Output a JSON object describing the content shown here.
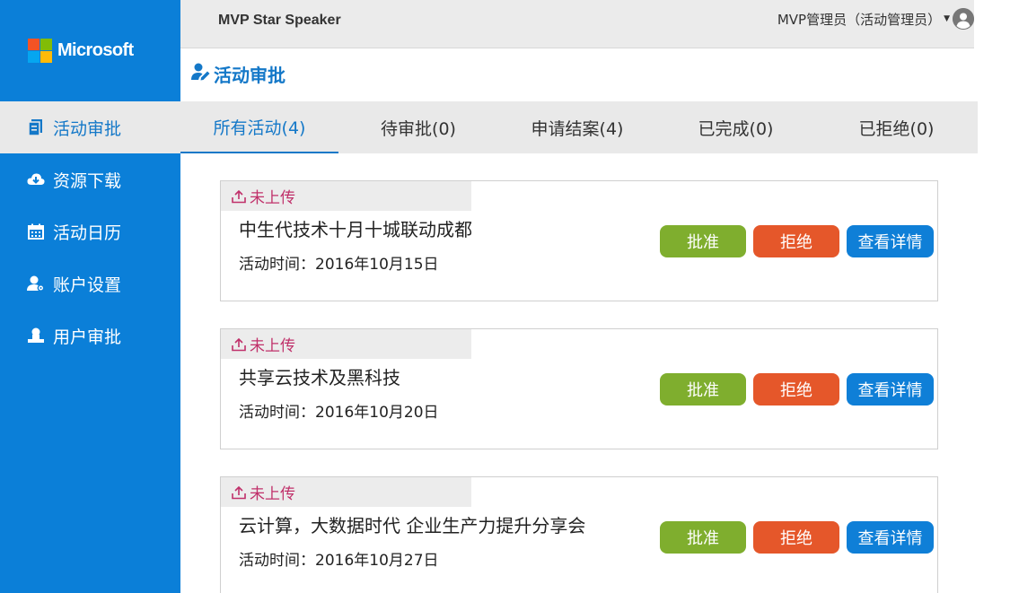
{
  "brand": {
    "name": "Microsoft",
    "colors": [
      "#f35325",
      "#81bc06",
      "#05a6f0",
      "#ffba08"
    ]
  },
  "sidebar": {
    "items": [
      {
        "label": "活动审批",
        "icon": "document-icon",
        "active": true
      },
      {
        "label": "资源下载",
        "icon": "cloud-download-icon",
        "active": false
      },
      {
        "label": "活动日历",
        "icon": "calendar-icon",
        "active": false
      },
      {
        "label": "账户设置",
        "icon": "user-settings-icon",
        "active": false
      },
      {
        "label": "用户审批",
        "icon": "user-approve-icon",
        "active": false
      }
    ]
  },
  "header": {
    "app_name": "MVP Star Speaker",
    "user": "MVP管理员（活动管理员）"
  },
  "page": {
    "title": "活动审批"
  },
  "tabs": [
    {
      "label": "所有活动(4)",
      "active": true
    },
    {
      "label": "待审批(0)",
      "active": false
    },
    {
      "label": "申请结案(4)",
      "active": false
    },
    {
      "label": "已完成(0)",
      "active": false
    },
    {
      "label": "已拒绝(0)",
      "active": false
    }
  ],
  "activities": [
    {
      "status": "未上传",
      "title": "中生代技术十月十城联动成都",
      "time": "活动时间：2016年10月15日"
    },
    {
      "status": "未上传",
      "title": "共享云技术及黑科技",
      "time": "活动时间：2016年10月20日"
    },
    {
      "status": "未上传",
      "title": "云计算，大数据时代 企业生产力提升分享会",
      "time": "活动时间：2016年10月27日"
    }
  ],
  "buttons": {
    "approve": "批准",
    "reject": "拒绝",
    "detail": "查看详情"
  },
  "colors": {
    "sidebar": "#0b7fd8",
    "accent": "#1478c8",
    "approve": "#7fae2e",
    "reject": "#e5572a",
    "detail": "#0f7fd7",
    "status_text": "#c0306a"
  }
}
